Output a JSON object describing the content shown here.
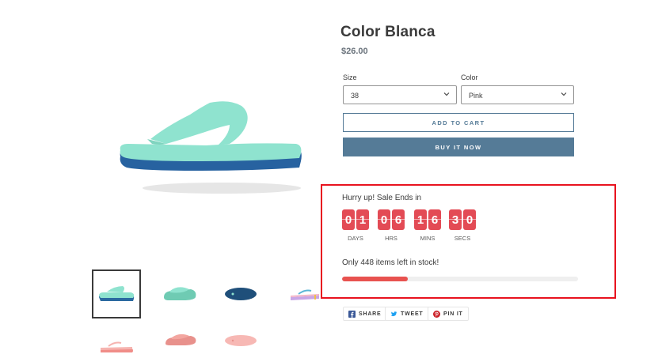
{
  "product": {
    "title": "Color Blanca",
    "price": "$26.00"
  },
  "options": {
    "size": {
      "label": "Size",
      "value": "38"
    },
    "color": {
      "label": "Color",
      "value": "Pink"
    }
  },
  "buttons": {
    "add_to_cart": "ADD TO CART",
    "buy_now": "BUY IT NOW"
  },
  "sale": {
    "heading": "Hurry up! Sale Ends in",
    "countdown": [
      {
        "digits": [
          "0",
          "1"
        ],
        "label": "DAYS"
      },
      {
        "digits": [
          "0",
          "6"
        ],
        "label": "HRS"
      },
      {
        "digits": [
          "1",
          "6"
        ],
        "label": "MINS"
      },
      {
        "digits": [
          "3",
          "0"
        ],
        "label": "SECS"
      }
    ],
    "stock_text": "Only 448 items left in stock!",
    "stock_fraction": 0.28,
    "bar_color": "#e8524f"
  },
  "social": {
    "share": "SHARE",
    "tweet": "TWEET",
    "pin": "PIN IT"
  },
  "colors": {
    "accent": "#557b97",
    "countdown": "#e34b55",
    "highlight_border": "#e8131f"
  },
  "thumbnails": [
    {
      "name": "mint-flip-flop",
      "color": "#8fe3cf",
      "sole": "#2b6aa0"
    },
    {
      "name": "mint-slide",
      "color": "#8fe3cf",
      "sole": "#6fcbb3"
    },
    {
      "name": "navy-flip-flop",
      "color": "#1f4f7a",
      "sole": "#1f4f7a"
    },
    {
      "name": "striped-flip-flop",
      "color": "#f3b6c8",
      "sole": "#c8a6e6"
    },
    {
      "name": "pink-flip-flop",
      "color": "#f6b4b0",
      "sole": "#f08d88"
    },
    {
      "name": "pink-slide",
      "color": "#f3a6a0",
      "sole": "#e8918c"
    },
    {
      "name": "pink-sole-flip-flop",
      "color": "#f7b8b4",
      "sole": "#f7b8b4"
    }
  ]
}
